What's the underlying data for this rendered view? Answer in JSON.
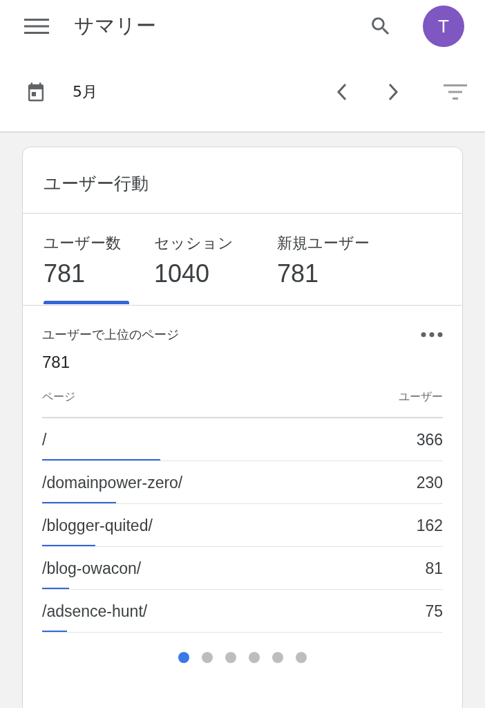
{
  "app_bar": {
    "title": "サマリー",
    "avatar": "T"
  },
  "date_bar": {
    "label": "5月"
  },
  "card": {
    "title": "ユーザー行動",
    "metrics": [
      {
        "label": "ユーザー数",
        "value": "781",
        "selected": true
      },
      {
        "label": "セッション",
        "value": "1040",
        "selected": false
      },
      {
        "label": "新規ユーザー",
        "value": "781",
        "selected": false
      }
    ],
    "panel": {
      "title": "ユーザーで上位のページ",
      "total": "781",
      "columns": [
        "ページ",
        "ユーザー"
      ],
      "rows": [
        {
          "page": "/",
          "users": "366",
          "level": 0.295
        },
        {
          "page": "/domainpower-zero/",
          "users": "230",
          "level": 0.185
        },
        {
          "page": "/blogger-quited/",
          "users": "162",
          "level": 0.132
        },
        {
          "page": "/blog-owacon/",
          "users": "81",
          "level": 0.067
        },
        {
          "page": "/adsence-hunt/",
          "users": "75",
          "level": 0.062
        }
      ]
    },
    "pages": [
      {
        "selected": true
      },
      {
        "selected": false
      },
      {
        "selected": false
      },
      {
        "selected": false
      },
      {
        "selected": false
      },
      {
        "selected": false
      }
    ]
  }
}
